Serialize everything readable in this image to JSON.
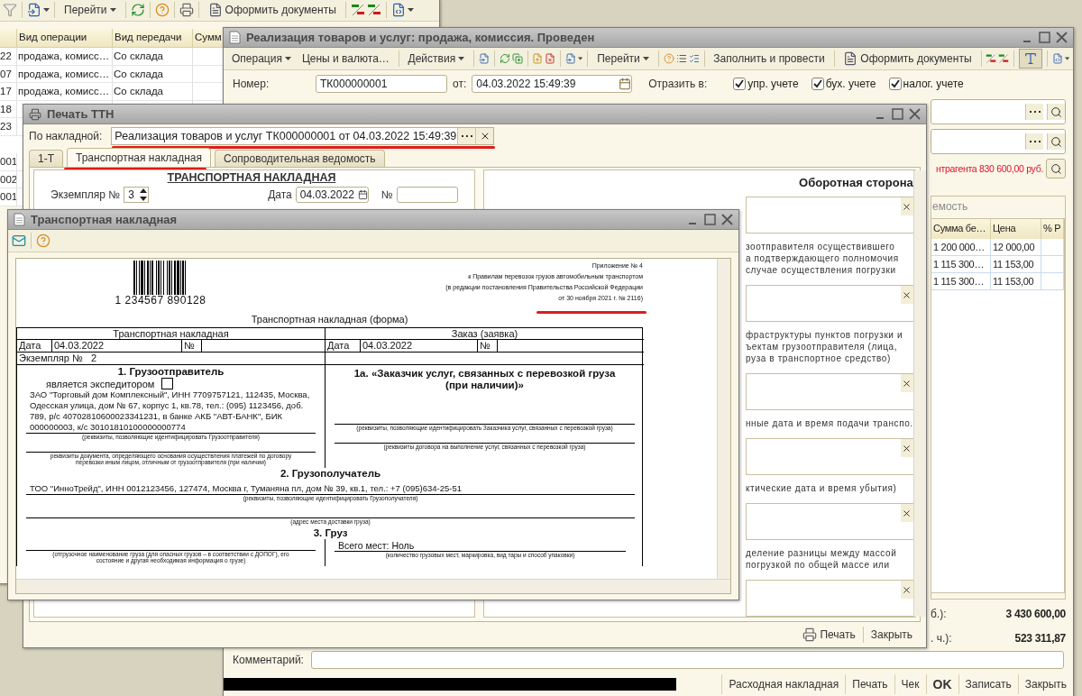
{
  "list_window": {
    "toolbar": [
      {
        "label": "Перейти",
        "dropdown": true
      },
      {
        "label": "Оформить документы",
        "dropdown": false
      }
    ],
    "columns": [
      "",
      "Вид операции",
      "Вид передачи",
      "Сумм"
    ],
    "rows": [
      {
        "cells": [
          "22",
          "продажа, комисс…",
          "Со склада"
        ]
      },
      {
        "cells": [
          "07",
          "продажа, комисс…",
          "Со склада"
        ]
      },
      {
        "cells": [
          "17",
          "продажа, комисс…",
          "Со склада"
        ]
      },
      {
        "cells": [
          "18"
        ]
      },
      {
        "cells": [
          "23"
        ]
      }
    ],
    "lower_rows": [
      "001",
      "002",
      "001"
    ]
  },
  "document_window": {
    "title": "Реализация товаров и услуг: продажа, комиссия. Проведен",
    "toolbar": [
      {
        "label": "Операция",
        "dropdown": true
      },
      {
        "label": "Цены и валюта…",
        "dropdown": false
      },
      {
        "label": "Действия",
        "dropdown": true
      },
      {
        "label": "Перейти",
        "dropdown": true
      },
      {
        "label": "Заполнить и провести",
        "dropdown": false
      },
      {
        "label": "Оформить документы",
        "dropdown": false
      }
    ],
    "number_label": "Номер:",
    "number": "ТК000000001",
    "date_label": "от:",
    "date": "04.03.2022 15:49:39",
    "reflect_label": "Отразить в:",
    "reflect": [
      {
        "label": "упр. учете",
        "checked": true
      },
      {
        "label": "бух. учете",
        "checked": true
      },
      {
        "label": "налог. учете",
        "checked": true
      }
    ],
    "debt_text": "нтрагента 830 600,00 руб.",
    "goods_tab": "емость",
    "goods_columns": [
      "Сумма бе…",
      "Цена",
      "% Р"
    ],
    "goods_rows": [
      [
        "1 200 000…",
        "12 000,00"
      ],
      [
        "1 115 300…",
        "11 153,00"
      ],
      [
        "1 115 300…",
        "11 153,00"
      ]
    ],
    "totals": [
      {
        "label": "б.):",
        "value": "3 430 600,00"
      },
      {
        "label": ". ч.):",
        "value": "523 311,87"
      }
    ],
    "comment_label": "Комментарий:",
    "buttons": [
      {
        "label": "Расходная накладная",
        "default": false
      },
      {
        "label": "Печать",
        "default": false
      },
      {
        "label": "Чек",
        "default": false
      },
      {
        "label": "OK",
        "default": true
      },
      {
        "label": "Записать",
        "default": false
      },
      {
        "label": "Закрыть",
        "default": false
      }
    ]
  },
  "print_window": {
    "title": "Печать ТТН",
    "source_label": "По накладной:",
    "source": "Реализация товаров и услуг ТК000000001 от 04.03.2022 15:49:39",
    "tabs": [
      {
        "label": "1-Т",
        "selected": false
      },
      {
        "label": "Транспортная накладная",
        "selected": true
      },
      {
        "label": "Сопроводительная ведомость",
        "selected": false
      }
    ],
    "form_heading": "ТРАНСПОРТНАЯ НАКЛАДНАЯ",
    "copy_label": "Экземпляр №",
    "copy": "3",
    "date_label": "Дата",
    "date": "04.03.2022",
    "number_label": "№",
    "back_heading": "Оборотная сторона",
    "back_hints": [
      {
        "lines": [
          "зоотправителя осуществившего",
          "а подтверждающего полномочия",
          "случае осуществления погрузки"
        ]
      },
      {
        "lines": [
          "фраструктуры пунктов погрузки и",
          "ъектам грузоотправителя (лица,",
          "руза в транспортное средство)"
        ]
      },
      {
        "lines": [
          "нные дата и время подачи транспо."
        ]
      },
      {
        "lines": [
          "ктические дата и время убытия)"
        ]
      },
      {
        "lines": [
          "деление разницы между массой",
          "погрузкой по общей массе или"
        ]
      }
    ],
    "buttons": [
      "Печать",
      "Закрыть"
    ]
  },
  "waybill_window": {
    "title": "Транспортная накладная",
    "appendix": [
      "Приложение № 4",
      "к Правилам перевозок грузов автомобильным транспортом",
      "(в редакции постановления Правительства Российской Федерации",
      "от 30 ноября 2021 г. № 2116)"
    ],
    "barcode_digits": "1 234567 890128",
    "form_title": "Транспортная накладная (форма)",
    "left_header": "Транспортная накладная",
    "right_header": "Заказ (заявка)",
    "date_label": "Дата",
    "left_date": "04.03.2022",
    "number_label": "№",
    "right_date_label": "Дата",
    "right_date": "04.03.2022",
    "right_number_label": "№",
    "copy_label": "Экземпляр №",
    "copy": "2",
    "shipper_heading": "1. Грузоотправитель",
    "forwarder": {
      "label": "является экспедитором",
      "checked": false
    },
    "shipper": "ЗАО \"Торговый дом Комплексный\", ИНН 7709757121, 112435, Москва, Одесская улица, дом № 67, корпус 1, кв.78, тел.: (095) 1123456, доб. 789, р/с 40702810600023341231, в банке АКБ \"АВТ-БАНК\", БИК 000000003, к/с 30101810100000000774",
    "shipper_caption": "(реквизиты, позволяющие идентифицировать Грузоотправителя)",
    "payment_caption": "реквизиты документа, определяющего основания осуществления платежей по договору перевозки иным лицом, отличным от грузоотправителя (при наличии)",
    "customer_heading": "1а. «Заказчик  услуг, связанных с перевозкой груза (при наличии)»",
    "customer_caption": "(реквизиты, позволяющие идентифицировать Заказчика услуг, связанных с перевозкой груза)",
    "contract_caption": "(реквизиты договора на выполнение услуг, связанных с перевозкой груза)",
    "consignee_heading": "2. Грузополучатель",
    "consignee": "ТОО \"ИнноТрейд\", ИНН 0012123456, 127474, Москва г, Туманяна пл, дом № 39, кв.1, тел.: +7 (095)634-25-51",
    "consignee_caption": "(реквизиты, позволяющие идентифицировать Грузополучателя)",
    "address_caption": "(адрес места доставки груза)",
    "cargo_heading": "3. Груз",
    "cargo_caption": "(отгрузочное наименование груза (для опасных грузов – в соответствии с ДОПОГ), его состояние и другая необходимая информация о грузе)",
    "places_label": "Всего мест:",
    "places": "Ноль",
    "places_caption": "(количество грузовых мест, маркировка, вид тары и способ упаковки)"
  }
}
